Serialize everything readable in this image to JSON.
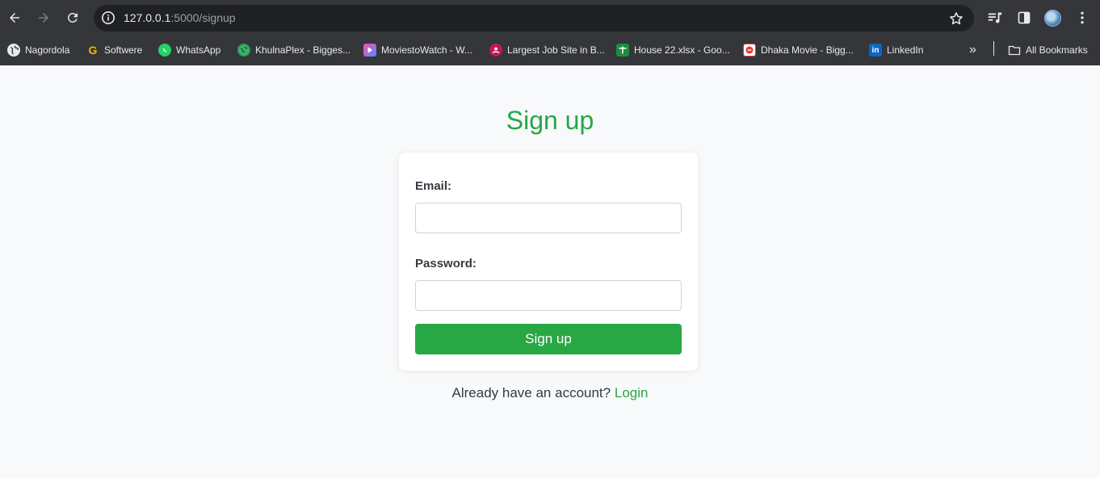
{
  "browser": {
    "url_host": "127.0.0.1",
    "url_path": ":5000/signup",
    "bookmarks": [
      {
        "label": "Nagordola",
        "icon": "globe-icon",
        "color": "#e8eaed"
      },
      {
        "label": "Softwere",
        "icon": "g-letter-icon",
        "color": "#f4b400"
      },
      {
        "label": "WhatsApp",
        "icon": "whatsapp-icon",
        "color": "#25d366"
      },
      {
        "label": "KhulnaPlex - Bigges...",
        "icon": "khulnaplex-icon",
        "color": "#2e9c5a"
      },
      {
        "label": "MoviestoWatch - W...",
        "icon": "play-icon",
        "color": "#6b6bf5"
      },
      {
        "label": "Largest Job Site in B...",
        "icon": "job-site-icon",
        "color": "#c2185b"
      },
      {
        "label": "House 22.xlsx - Goo...",
        "icon": "sheets-icon",
        "color": "#1e8e3e"
      },
      {
        "label": "Dhaka Movie - Bigg...",
        "icon": "dhaka-movie-icon",
        "color": "#e53935"
      },
      {
        "label": "LinkedIn",
        "icon": "linkedin-icon",
        "color": "#0a66c2"
      }
    ],
    "overflow_label": "»",
    "all_bookmarks_label": "All Bookmarks"
  },
  "page": {
    "title": "Sign up",
    "email_label": "Email:",
    "email_value": "",
    "password_label": "Password:",
    "password_value": "",
    "submit_label": "Sign up",
    "login_prompt": "Already have an account?",
    "login_link": "Login"
  },
  "colors": {
    "accent": "#28a745",
    "page_bg": "#f8f9fa",
    "chrome_bg": "#35363a"
  }
}
